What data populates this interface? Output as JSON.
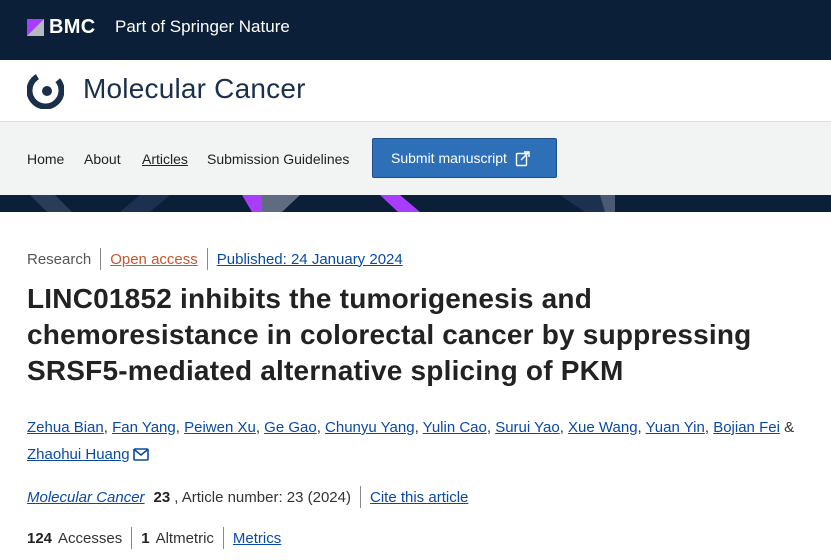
{
  "brand_bar": {
    "logo_text": "BMC",
    "part_of_text": "Part of Springer Nature"
  },
  "journal": {
    "title": "Molecular Cancer"
  },
  "nav": {
    "items": [
      {
        "label": "Home"
      },
      {
        "label": "About"
      },
      {
        "label": "Articles"
      },
      {
        "label": "Submission Guidelines"
      }
    ],
    "submit_label": "Submit manuscript"
  },
  "article": {
    "type": "Research",
    "access": "Open access",
    "published": "Published: 24 January 2024",
    "title": "LINC01852 inhibits the tumorigenesis and chemoresistance in colorectal cancer by suppressing SRSF5-mediated alternative splicing of PKM",
    "authors": [
      "Zehua Bian",
      "Fan Yang",
      "Peiwen Xu",
      "Ge Gao",
      "Chunyu Yang",
      "Yulin Cao",
      "Surui Yao",
      "Xue Wang",
      "Yuan Yin",
      "Bojian Fei",
      "Zhaohui Huang"
    ],
    "author_separator": ", ",
    "author_last_separator": " & ",
    "citation": {
      "journal": "Molecular Cancer",
      "volume": "23",
      "article_number": ", Article number: 23 (2024)",
      "cite_label": "Cite this article"
    },
    "metrics": {
      "accesses_count": "124",
      "accesses_label": "Accesses",
      "altmetric_count": "1",
      "altmetric_label": "Altmetric",
      "metrics_label": "Metrics"
    }
  },
  "colors": {
    "brand_navy": "#0c1f38",
    "link_blue": "#0a4aa5",
    "open_access_orange": "#c5572d",
    "button_blue": "#2e70b8",
    "accent_purple": "#a83dff"
  },
  "icons": {
    "submit": "external-upload-icon",
    "mail": "mail-icon"
  }
}
